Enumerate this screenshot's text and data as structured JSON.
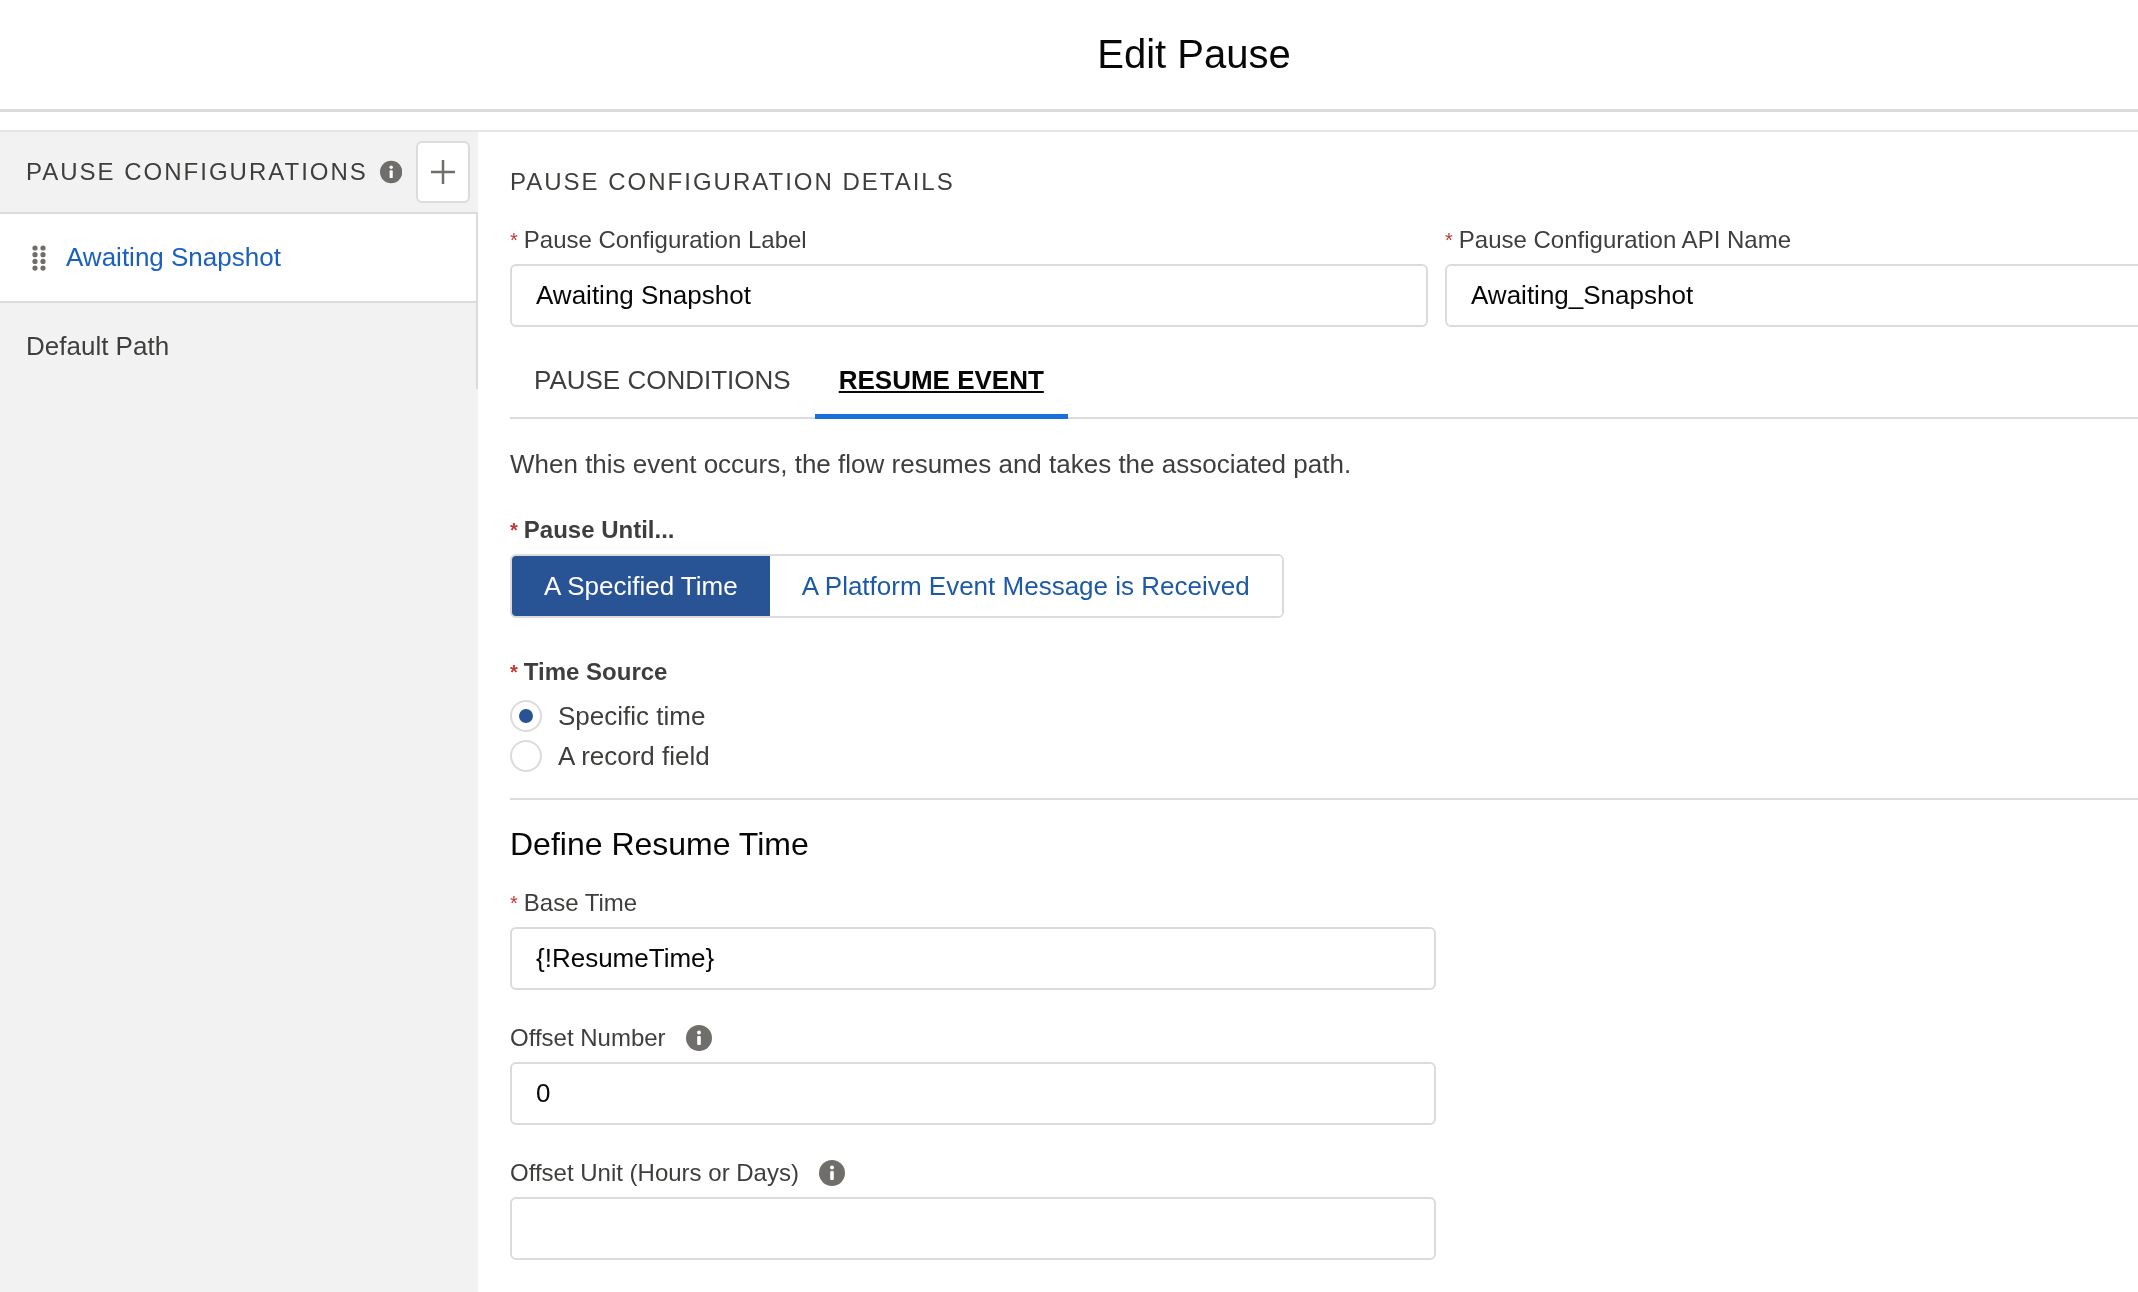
{
  "header": {
    "title": "Edit Pause"
  },
  "sidebar": {
    "title": "PAUSE CONFIGURATIONS",
    "items": [
      {
        "label": "Awaiting Snapshot",
        "selected": true,
        "draggable": true
      },
      {
        "label": "Default Path",
        "selected": false,
        "draggable": false
      }
    ]
  },
  "details": {
    "title": "PAUSE CONFIGURATION DETAILS",
    "fields": [
      {
        "label": "Pause Configuration Label",
        "required_mark": "*",
        "value": "Awaiting Snapshot"
      },
      {
        "label": "Pause Configuration API Name",
        "required_mark": "*",
        "value": "Awaiting_Snapshot"
      }
    ]
  },
  "tabs": [
    {
      "label": "PAUSE CONDITIONS",
      "selected": false
    },
    {
      "label": "RESUME EVENT",
      "selected": true
    }
  ],
  "resume_event": {
    "description": "When this event occurs, the flow resumes and takes the associated path.",
    "pause_until": {
      "label": "Pause Until...",
      "required_mark": "*",
      "options": [
        {
          "label": "A Specified Time",
          "selected": true
        },
        {
          "label": "A Platform Event Message is Received",
          "selected": false
        }
      ]
    },
    "time_source": {
      "label": "Time Source",
      "required_mark": "*",
      "options": [
        {
          "label": "Specific time",
          "selected": true
        },
        {
          "label": "A record field",
          "selected": false
        }
      ]
    },
    "section_title": "Define Resume Time",
    "fields": [
      {
        "label": "Base Time",
        "required_mark": "*",
        "info": false,
        "value": "{!ResumeTime}"
      },
      {
        "label": "Offset Number",
        "info": true,
        "value": "0"
      },
      {
        "label": "Offset Unit (Hours or Days)",
        "info": true
      }
    ]
  }
}
